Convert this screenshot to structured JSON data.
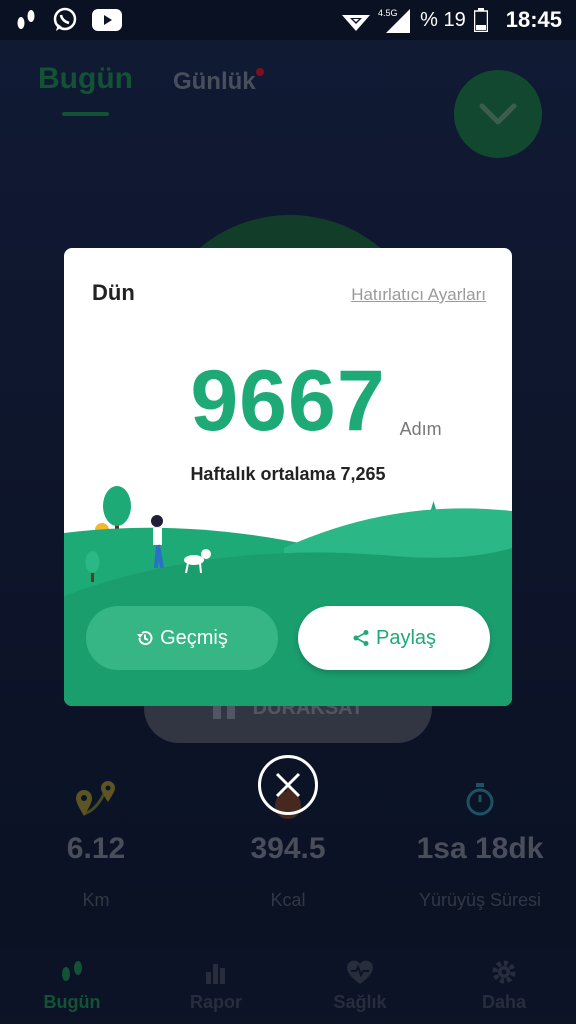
{
  "status_bar": {
    "network": "4.5G",
    "battery": "% 19",
    "time": "18:45"
  },
  "background": {
    "tabs": [
      {
        "label": "Bugün"
      },
      {
        "label": "Günlük"
      }
    ],
    "pause_button_label": "DURAKSAT",
    "stats": [
      {
        "value": "6.12",
        "label": "Km",
        "icon": "location-pins-icon"
      },
      {
        "value": "394.5",
        "label": "Kcal",
        "icon": "flame-icon"
      },
      {
        "value": "1sa 18dk",
        "label": "Yürüyüş Süresi",
        "icon": "stopwatch-icon"
      }
    ],
    "nav": [
      {
        "label": "Bugün",
        "icon": "footsteps-icon"
      },
      {
        "label": "Rapor",
        "icon": "bar-chart-icon"
      },
      {
        "label": "Sağlık",
        "icon": "heart-pulse-icon"
      },
      {
        "label": "Daha",
        "icon": "gear-icon"
      }
    ]
  },
  "modal": {
    "title": "Dün",
    "reminder_link": "Hatırlatıcı Ayarları",
    "steps": "9667",
    "steps_unit": "Adım",
    "weekly_average": "Haftalık ortalama 7,265",
    "history_button": "Geçmiş",
    "share_button": "Paylaş"
  },
  "colors": {
    "accent": "#1eaa77",
    "accent_dark": "#1a7a45",
    "background": "#0d1629"
  }
}
